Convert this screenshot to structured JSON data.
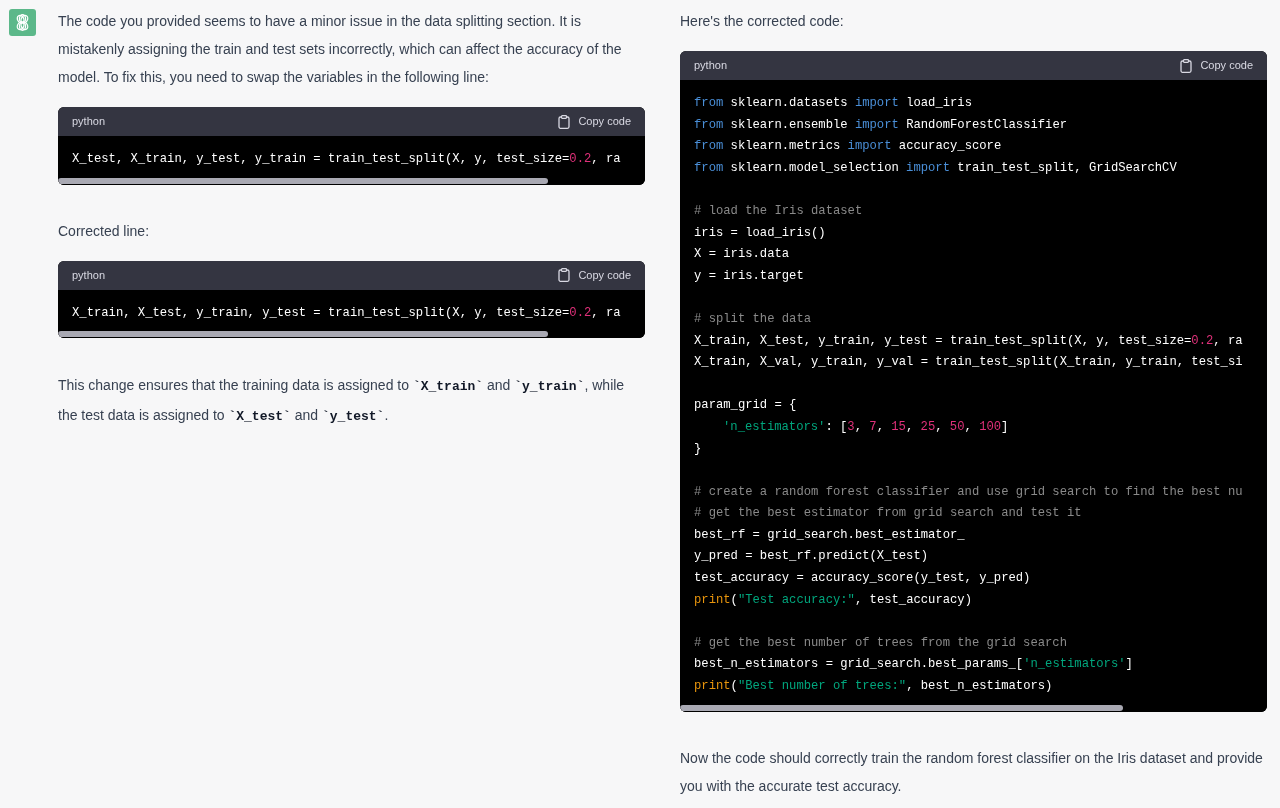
{
  "left": {
    "blocks": [
      {
        "kind": "paragraph",
        "segments": [
          {
            "kind": "text",
            "text": "The code you provided seems to have a minor issue in the data splitting section. It is mistakenly assigning the train and test sets incorrectly, which can affect the accuracy of the model. To fix this, you need to swap the variables in the following line:"
          }
        ]
      },
      {
        "kind": "code",
        "language": "python",
        "copy_label": "Copy code",
        "lines": [
          {
            "kind": "code",
            "tokens": [
              {
                "kind": "plain",
                "text": "X_test, X_train, y_test, y_train = train_test_split(X, y, test_size="
              },
              {
                "kind": "number",
                "text": "0.2"
              },
              {
                "kind": "plain",
                "text": ", ra"
              }
            ]
          }
        ]
      },
      {
        "kind": "paragraph",
        "segments": [
          {
            "kind": "text",
            "text": "Corrected line:"
          }
        ]
      },
      {
        "kind": "code",
        "language": "python",
        "copy_label": "Copy code",
        "lines": [
          {
            "kind": "code",
            "tokens": [
              {
                "kind": "plain",
                "text": "X_train, X_test, y_train, y_test = train_test_split(X, y, test_size="
              },
              {
                "kind": "number",
                "text": "0.2"
              },
              {
                "kind": "plain",
                "text": ", ra"
              }
            ]
          }
        ]
      },
      {
        "kind": "paragraph",
        "segments": [
          {
            "kind": "text",
            "text": "This change ensures that the training data is assigned to "
          },
          {
            "kind": "code",
            "text": "`X_train`"
          },
          {
            "kind": "text",
            "text": " and "
          },
          {
            "kind": "code",
            "text": "`y_train`"
          },
          {
            "kind": "text",
            "text": ", while the test data is assigned to "
          },
          {
            "kind": "code",
            "text": "`X_test`"
          },
          {
            "kind": "text",
            "text": " and "
          },
          {
            "kind": "code",
            "text": "`y_test`"
          },
          {
            "kind": "text",
            "text": "."
          }
        ]
      }
    ]
  },
  "right": {
    "blocks": [
      {
        "kind": "paragraph",
        "segments": [
          {
            "kind": "text",
            "text": "Here's the corrected code:"
          }
        ]
      },
      {
        "kind": "code",
        "language": "python",
        "copy_label": "Copy code",
        "lines": [
          {
            "kind": "code",
            "tokens": [
              {
                "kind": "keyword",
                "text": "from"
              },
              {
                "kind": "plain",
                "text": " sklearn.datasets "
              },
              {
                "kind": "keyword",
                "text": "import"
              },
              {
                "kind": "plain",
                "text": " load_iris"
              }
            ]
          },
          {
            "kind": "code",
            "tokens": [
              {
                "kind": "keyword",
                "text": "from"
              },
              {
                "kind": "plain",
                "text": " sklearn.ensemble "
              },
              {
                "kind": "keyword",
                "text": "import"
              },
              {
                "kind": "plain",
                "text": " RandomForestClassifier"
              }
            ]
          },
          {
            "kind": "code",
            "tokens": [
              {
                "kind": "keyword",
                "text": "from"
              },
              {
                "kind": "plain",
                "text": " sklearn.metrics "
              },
              {
                "kind": "keyword",
                "text": "import"
              },
              {
                "kind": "plain",
                "text": " accuracy_score"
              }
            ]
          },
          {
            "kind": "code",
            "tokens": [
              {
                "kind": "keyword",
                "text": "from"
              },
              {
                "kind": "plain",
                "text": " sklearn.model_selection "
              },
              {
                "kind": "keyword",
                "text": "import"
              },
              {
                "kind": "plain",
                "text": " train_test_split, GridSearchCV"
              }
            ]
          },
          {
            "kind": "blank"
          },
          {
            "kind": "code",
            "tokens": [
              {
                "kind": "comment",
                "text": "# load the Iris dataset"
              }
            ]
          },
          {
            "kind": "code",
            "tokens": [
              {
                "kind": "plain",
                "text": "iris = load_iris()"
              }
            ]
          },
          {
            "kind": "code",
            "tokens": [
              {
                "kind": "plain",
                "text": "X = iris.data"
              }
            ]
          },
          {
            "kind": "code",
            "tokens": [
              {
                "kind": "plain",
                "text": "y = iris.target"
              }
            ]
          },
          {
            "kind": "blank"
          },
          {
            "kind": "code",
            "tokens": [
              {
                "kind": "comment",
                "text": "# split the data"
              }
            ]
          },
          {
            "kind": "code",
            "tokens": [
              {
                "kind": "plain",
                "text": "X_train, X_test, y_train, y_test = train_test_split(X, y, test_size="
              },
              {
                "kind": "number",
                "text": "0.2"
              },
              {
                "kind": "plain",
                "text": ", ra"
              }
            ]
          },
          {
            "kind": "code",
            "tokens": [
              {
                "kind": "plain",
                "text": "X_train, X_val, y_train, y_val = train_test_split(X_train, y_train, test_si"
              }
            ]
          },
          {
            "kind": "blank"
          },
          {
            "kind": "code",
            "tokens": [
              {
                "kind": "plain",
                "text": "param_grid = {"
              }
            ]
          },
          {
            "kind": "indented",
            "tokens": [
              {
                "kind": "string",
                "text": "'n_estimators'"
              },
              {
                "kind": "plain",
                "text": ": ["
              },
              {
                "kind": "number",
                "text": "3"
              },
              {
                "kind": "plain",
                "text": ", "
              },
              {
                "kind": "number",
                "text": "7"
              },
              {
                "kind": "plain",
                "text": ", "
              },
              {
                "kind": "number",
                "text": "15"
              },
              {
                "kind": "plain",
                "text": ", "
              },
              {
                "kind": "number",
                "text": "25"
              },
              {
                "kind": "plain",
                "text": ", "
              },
              {
                "kind": "number",
                "text": "50"
              },
              {
                "kind": "plain",
                "text": ", "
              },
              {
                "kind": "number",
                "text": "100"
              },
              {
                "kind": "plain",
                "text": "]"
              }
            ]
          },
          {
            "kind": "code",
            "tokens": [
              {
                "kind": "plain",
                "text": "}"
              }
            ]
          },
          {
            "kind": "blank"
          },
          {
            "kind": "code",
            "tokens": [
              {
                "kind": "comment",
                "text": "# create a random forest classifier and use grid search to find the best nu"
              }
            ]
          },
          {
            "kind": "code",
            "tokens": [
              {
                "kind": "comment",
                "text": "# get the best estimator from grid search and test it"
              }
            ]
          },
          {
            "kind": "code",
            "tokens": [
              {
                "kind": "plain",
                "text": "best_rf = grid_search.best_estimator_"
              }
            ]
          },
          {
            "kind": "code",
            "tokens": [
              {
                "kind": "plain",
                "text": "y_pred = best_rf.predict(X_test)"
              }
            ]
          },
          {
            "kind": "code",
            "tokens": [
              {
                "kind": "plain",
                "text": "test_accuracy = accuracy_score(y_test, y_pred)"
              }
            ]
          },
          {
            "kind": "code",
            "tokens": [
              {
                "kind": "builtin",
                "text": "print"
              },
              {
                "kind": "plain",
                "text": "("
              },
              {
                "kind": "string",
                "text": "\"Test accuracy:\""
              },
              {
                "kind": "plain",
                "text": ", test_accuracy)"
              }
            ]
          },
          {
            "kind": "blank"
          },
          {
            "kind": "code",
            "tokens": [
              {
                "kind": "comment",
                "text": "# get the best number of trees from the grid search"
              }
            ]
          },
          {
            "kind": "code",
            "tokens": [
              {
                "kind": "plain",
                "text": "best_n_estimators = grid_search.best_params_["
              },
              {
                "kind": "string",
                "text": "'n_estimators'"
              },
              {
                "kind": "plain",
                "text": "]"
              }
            ]
          },
          {
            "kind": "code",
            "tokens": [
              {
                "kind": "builtin",
                "text": "print"
              },
              {
                "kind": "plain",
                "text": "("
              },
              {
                "kind": "string",
                "text": "\"Best number of trees:\""
              },
              {
                "kind": "plain",
                "text": ", best_n_estimators)"
              }
            ]
          }
        ]
      },
      {
        "kind": "paragraph",
        "segments": [
          {
            "kind": "text",
            "text": "Now the code should correctly train the random forest classifier on the Iris dataset and provide you with the accurate test accuracy."
          }
        ]
      }
    ]
  }
}
